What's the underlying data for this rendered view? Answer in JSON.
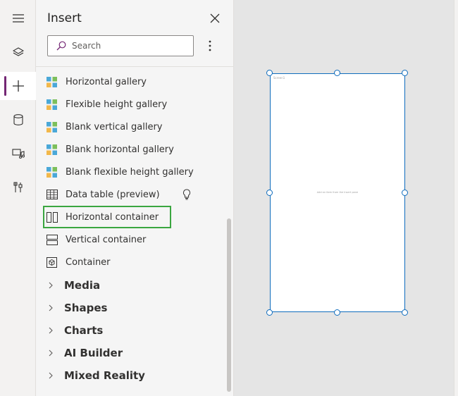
{
  "pane": {
    "title": "Insert",
    "search": {
      "placeholder": "Search",
      "value": ""
    }
  },
  "items": [
    {
      "label": "Horizontal gallery",
      "icon": "gallery-icon"
    },
    {
      "label": "Flexible height gallery",
      "icon": "gallery-icon"
    },
    {
      "label": "Blank vertical gallery",
      "icon": "gallery-icon"
    },
    {
      "label": "Blank horizontal gallery",
      "icon": "gallery-icon"
    },
    {
      "label": "Blank flexible height gallery",
      "icon": "gallery-icon"
    },
    {
      "label": "Data table (preview)",
      "icon": "table-icon"
    },
    {
      "label": "Horizontal container",
      "icon": "horizontal-container-icon"
    },
    {
      "label": "Vertical container",
      "icon": "vertical-container-icon"
    },
    {
      "label": "Container",
      "icon": "container-icon"
    }
  ],
  "groups": [
    {
      "label": "Media"
    },
    {
      "label": "Shapes"
    },
    {
      "label": "Charts"
    },
    {
      "label": "AI Builder"
    },
    {
      "label": "Mixed Reality"
    }
  ],
  "canvas": {
    "screen_label": "Screen1",
    "screen_hint": "Add an item from the Insert pane"
  },
  "colors": {
    "accent": "#742774",
    "selection": "#0f6cbd",
    "highlight": "#3aa640"
  }
}
